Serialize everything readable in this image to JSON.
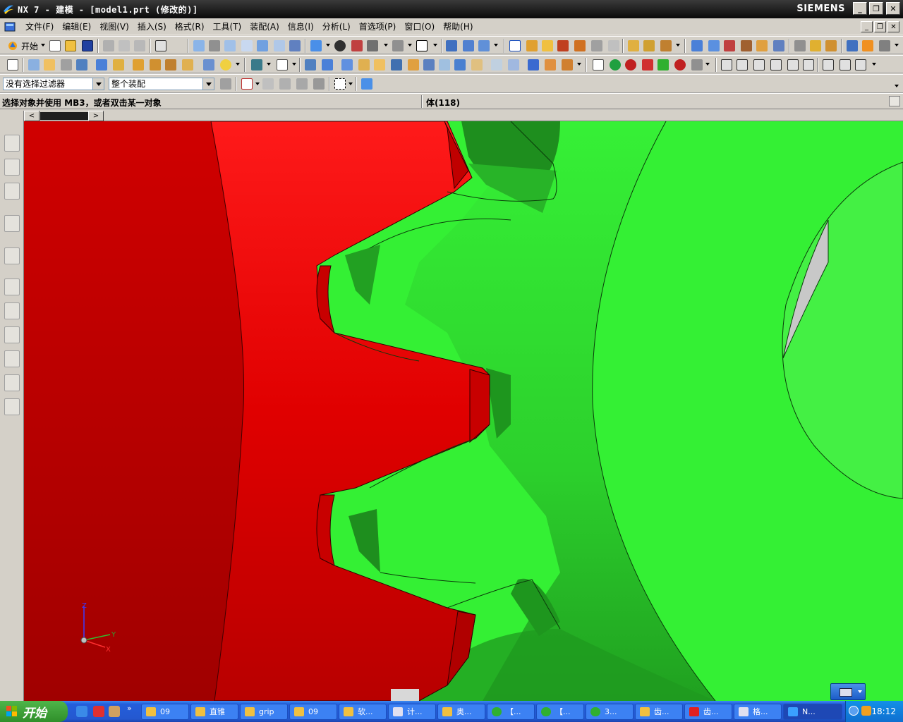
{
  "window": {
    "title": "NX 7 - 建模 - [model1.prt (修改的)]",
    "brand": "SIEMENS",
    "controls": [
      "minimize",
      "restore",
      "close"
    ]
  },
  "menubar": {
    "items": [
      "文件(F)",
      "编辑(E)",
      "视图(V)",
      "插入(S)",
      "格式(R)",
      "工具(T)",
      "装配(A)",
      "信息(I)",
      "分析(L)",
      "首选项(P)",
      "窗口(O)",
      "帮助(H)"
    ]
  },
  "toolbar": {
    "start_label": "开始"
  },
  "selection_bar": {
    "filter_value": "没有选择过滤器",
    "scope_value": "整个装配"
  },
  "status": {
    "prompt": "选择对象并使用 MB3，或者双击某一对象",
    "info": "体(118)"
  },
  "colors": {
    "gear_red": "#e00000",
    "gear_green": "#30f030",
    "gear_green_dark": "#1ea01e",
    "titlebar": "#000000"
  },
  "triad": {
    "z": "Z",
    "y": "Y",
    "x": "X"
  },
  "taskbar": {
    "start": "开始",
    "tasks": [
      "09",
      "直锥",
      "grip",
      "09",
      "软...",
      "计...",
      "奥...",
      "【...",
      "【...",
      "3...",
      "齿...",
      "齿...",
      "格...",
      "N..."
    ],
    "clock": "18:12"
  }
}
